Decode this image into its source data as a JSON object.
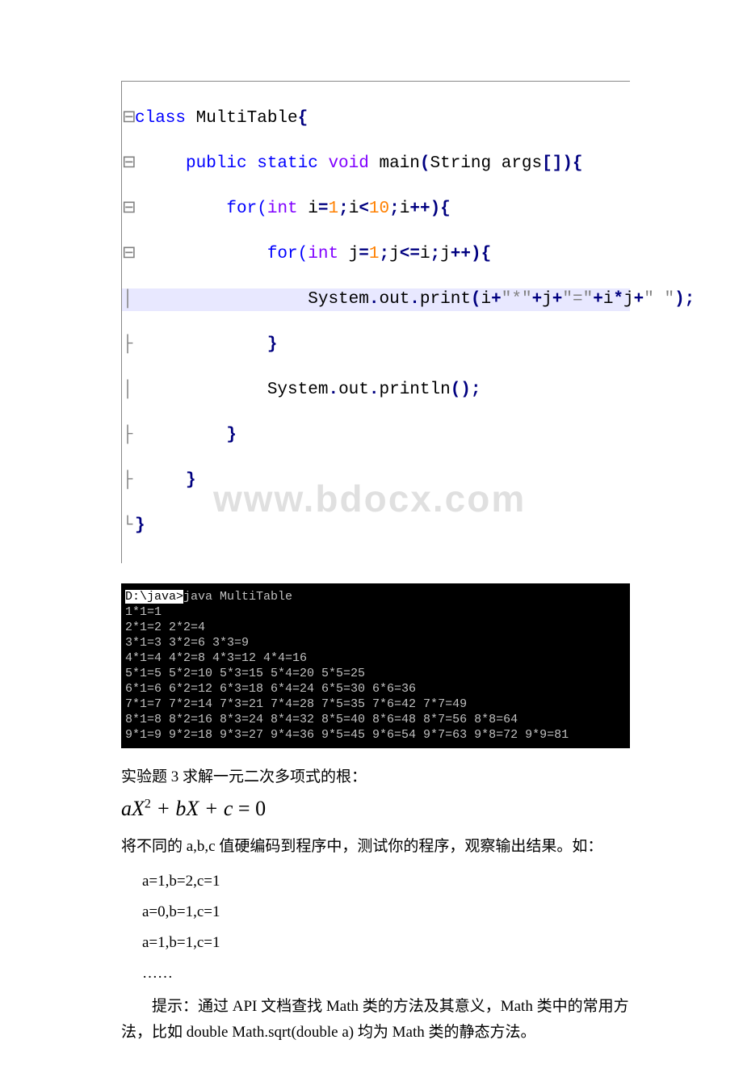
{
  "code": {
    "fold_open_top": "⊟",
    "fold_open": "⊟",
    "fold_mid": "│",
    "fold_cont": "├",
    "fold_end": "└",
    "line1_a": "class",
    "line1_b": " MultiTable",
    "line1_c": "{",
    "line2_a": "public static ",
    "line2_ret": "void",
    "line2_b": " main",
    "line2_c": "(",
    "line2_d": "String args",
    "line2_e": "[]){",
    "line3_a": "for(",
    "line3_int": "int",
    "line3_b": " i",
    "line3_eq": "=",
    "line3_one": "1",
    "line3_semi": ";",
    "line3_c": "i",
    "line3_lt": "<",
    "line3_ten": "10",
    "line3_semi2": ";",
    "line3_d": "i",
    "line3_inc": "++){",
    "line4_a": "for(",
    "line4_int": "int",
    "line4_b": " j",
    "line4_eq": "=",
    "line4_one": "1",
    "line4_semi": ";",
    "line4_c": "j",
    "line4_le": "<=",
    "line4_d": "i",
    "line4_semi2": ";",
    "line4_e": "j",
    "line4_inc": "++){",
    "line5_a": "System",
    "line5_b": ".",
    "line5_c": "out",
    "line5_d": ".",
    "line5_e": "print",
    "line5_f": "(",
    "line5_g": "i",
    "line5_plus1": "+",
    "line5_s1": "\"*\"",
    "line5_plus2": "+",
    "line5_h": "j",
    "line5_plus3": "+",
    "line5_s2": "\"=\"",
    "line5_plus4": "+",
    "line5_i": "i",
    "line5_mul": "*",
    "line5_j": "j",
    "line5_plus5": "+",
    "line5_s3": "\" \"",
    "line5_k": ");",
    "brace": "}",
    "line7_a": "System",
    "line7_b": ".",
    "line7_c": "out",
    "line7_d": ".",
    "line7_e": "println",
    "line7_f": "();"
  },
  "console": {
    "prompt_dir": "D:\\java>",
    "cmd": "java MultiTable",
    "rows": [
      "1*1=1",
      "2*1=2 2*2=4",
      "3*1=3 3*2=6 3*3=9",
      "4*1=4 4*2=8 4*3=12 4*4=16",
      "5*1=5 5*2=10 5*3=15 5*4=20 5*5=25",
      "6*1=6 6*2=12 6*3=18 6*4=24 6*5=30 6*6=36",
      "7*1=7 7*2=14 7*3=21 7*4=28 7*5=35 7*6=42 7*7=49",
      "8*1=8 8*2=16 8*3=24 8*4=32 8*5=40 8*6=48 8*7=56 8*8=64",
      "9*1=9 9*2=18 9*3=27 9*4=36 9*5=45 9*6=54 9*7=63 9*8=72 9*9=81"
    ]
  },
  "body": {
    "title3": "实验题 3 求解一元二次多项式的根：",
    "equation": {
      "a": "aX",
      "sup": "2",
      "mid": " + bX + c ",
      "eq": "=",
      "zero": " 0"
    },
    "desc": "将不同的 a,b,c 值硬编码到程序中，测试你的程序，观察输出结果。如：",
    "abc1": "a=1,b=2,c=1",
    "abc2": "a=0,b=1,c=1",
    "abc3": "a=1,b=1,c=1",
    "ell": "……",
    "hint": "提示：通过 API 文档查找 Math 类的方法及其意义，Math 类中的常用方法，比如 double Math.sqrt(double a) 均为 Math 类的静态方法。"
  },
  "watermark": "www.bdocx.com"
}
